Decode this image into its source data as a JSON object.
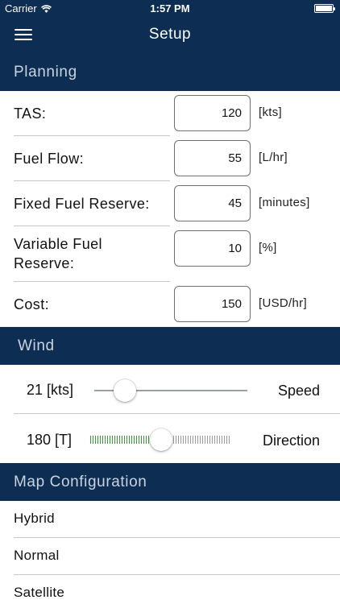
{
  "status_bar": {
    "carrier": "Carrier",
    "time": "1:57 PM"
  },
  "nav": {
    "title": "Setup"
  },
  "planning": {
    "header": "Planning",
    "rows": [
      {
        "label": "TAS:",
        "value": "120",
        "unit": "[kts]"
      },
      {
        "label": "Fuel Flow:",
        "value": "55",
        "unit": "[L/hr]"
      },
      {
        "label": "Fixed Fuel Reserve:",
        "value": "45",
        "unit": "[minutes]"
      },
      {
        "label": "Variable Fuel\nReserve:",
        "value": "10",
        "unit": "[%]"
      },
      {
        "label": "Cost:",
        "value": "150",
        "unit": "[USD/hr]"
      }
    ]
  },
  "wind": {
    "header": "Wind",
    "speed": {
      "value": "21 [kts]",
      "label": "Speed",
      "fraction": 0.2
    },
    "direction": {
      "value": "180 [T]",
      "label": "Direction",
      "fraction": 0.5
    }
  },
  "map_config": {
    "header": "Map Configuration",
    "items": [
      "Hybrid",
      "Normal",
      "Satellite"
    ]
  }
}
